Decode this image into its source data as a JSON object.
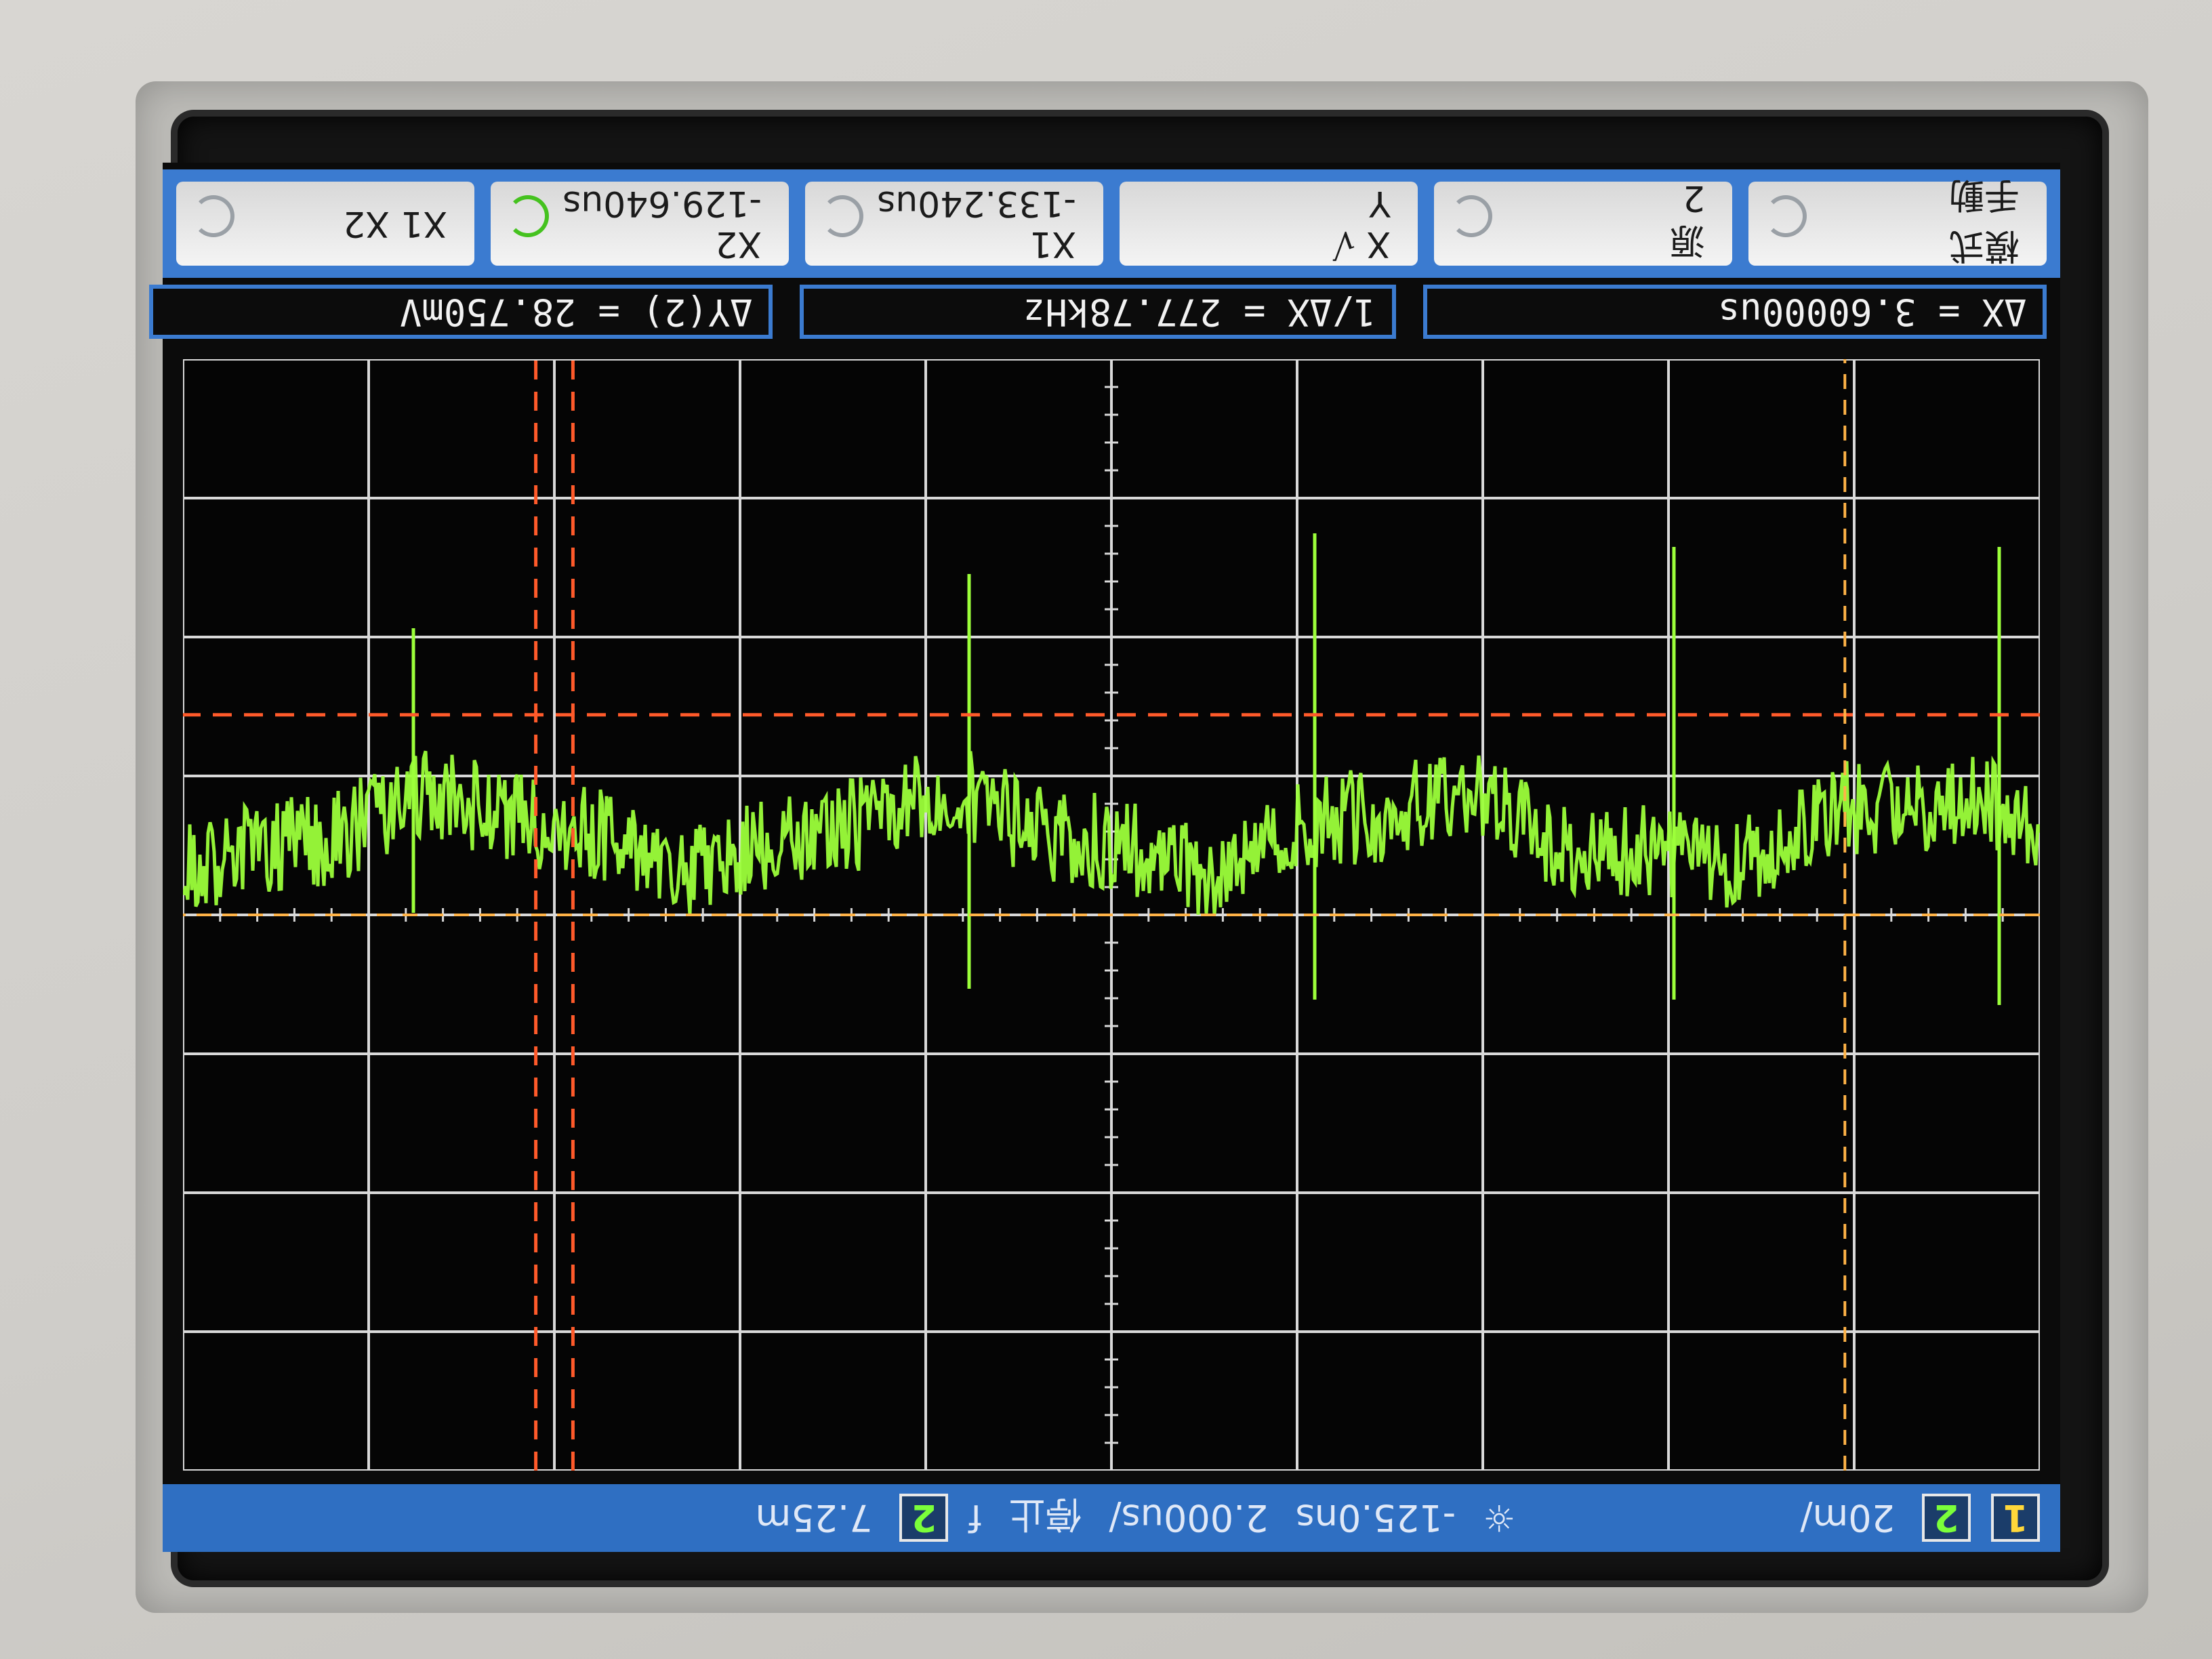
{
  "status": {
    "ch1_badge": "1",
    "ch2_scale": "20m/",
    "ch2_badge": "2",
    "ch2_badge_right": "2",
    "trigger_icon": "sun-icon",
    "delay": "-125.0ns",
    "timebase": "2.000us/",
    "run_state": "停止",
    "trigger_slope": "f",
    "trigger_level": "7.25m"
  },
  "readouts": {
    "delta_x": "ΔX = 3.60000us",
    "inv_delta_x": "1/ΔX = 277.78kHz",
    "delta_y": "ΔY(2) = 28.750mV"
  },
  "softkeys": [
    {
      "l1": "模式",
      "l2": "手動",
      "active": false
    },
    {
      "l1": "源",
      "l2": "2",
      "active": false
    },
    {
      "l1": "X",
      "l2": "Y",
      "active": false,
      "note": "√"
    },
    {
      "l1": "X1",
      "l2": "-133.240us",
      "active": false
    },
    {
      "l1": "X2",
      "l2": "-129.640us",
      "active": true
    },
    {
      "l1": "X1 X2",
      "l2": "",
      "active": false
    }
  ],
  "markers": {
    "ch2_marker": "2",
    "ch1_marker": "1"
  },
  "colors": {
    "trace": "#9cff3a",
    "grid": "#d9d9d9",
    "cursor": "#ff5a2a",
    "cursor_x": "#ffb347",
    "bar": "#3b7bd0"
  }
}
